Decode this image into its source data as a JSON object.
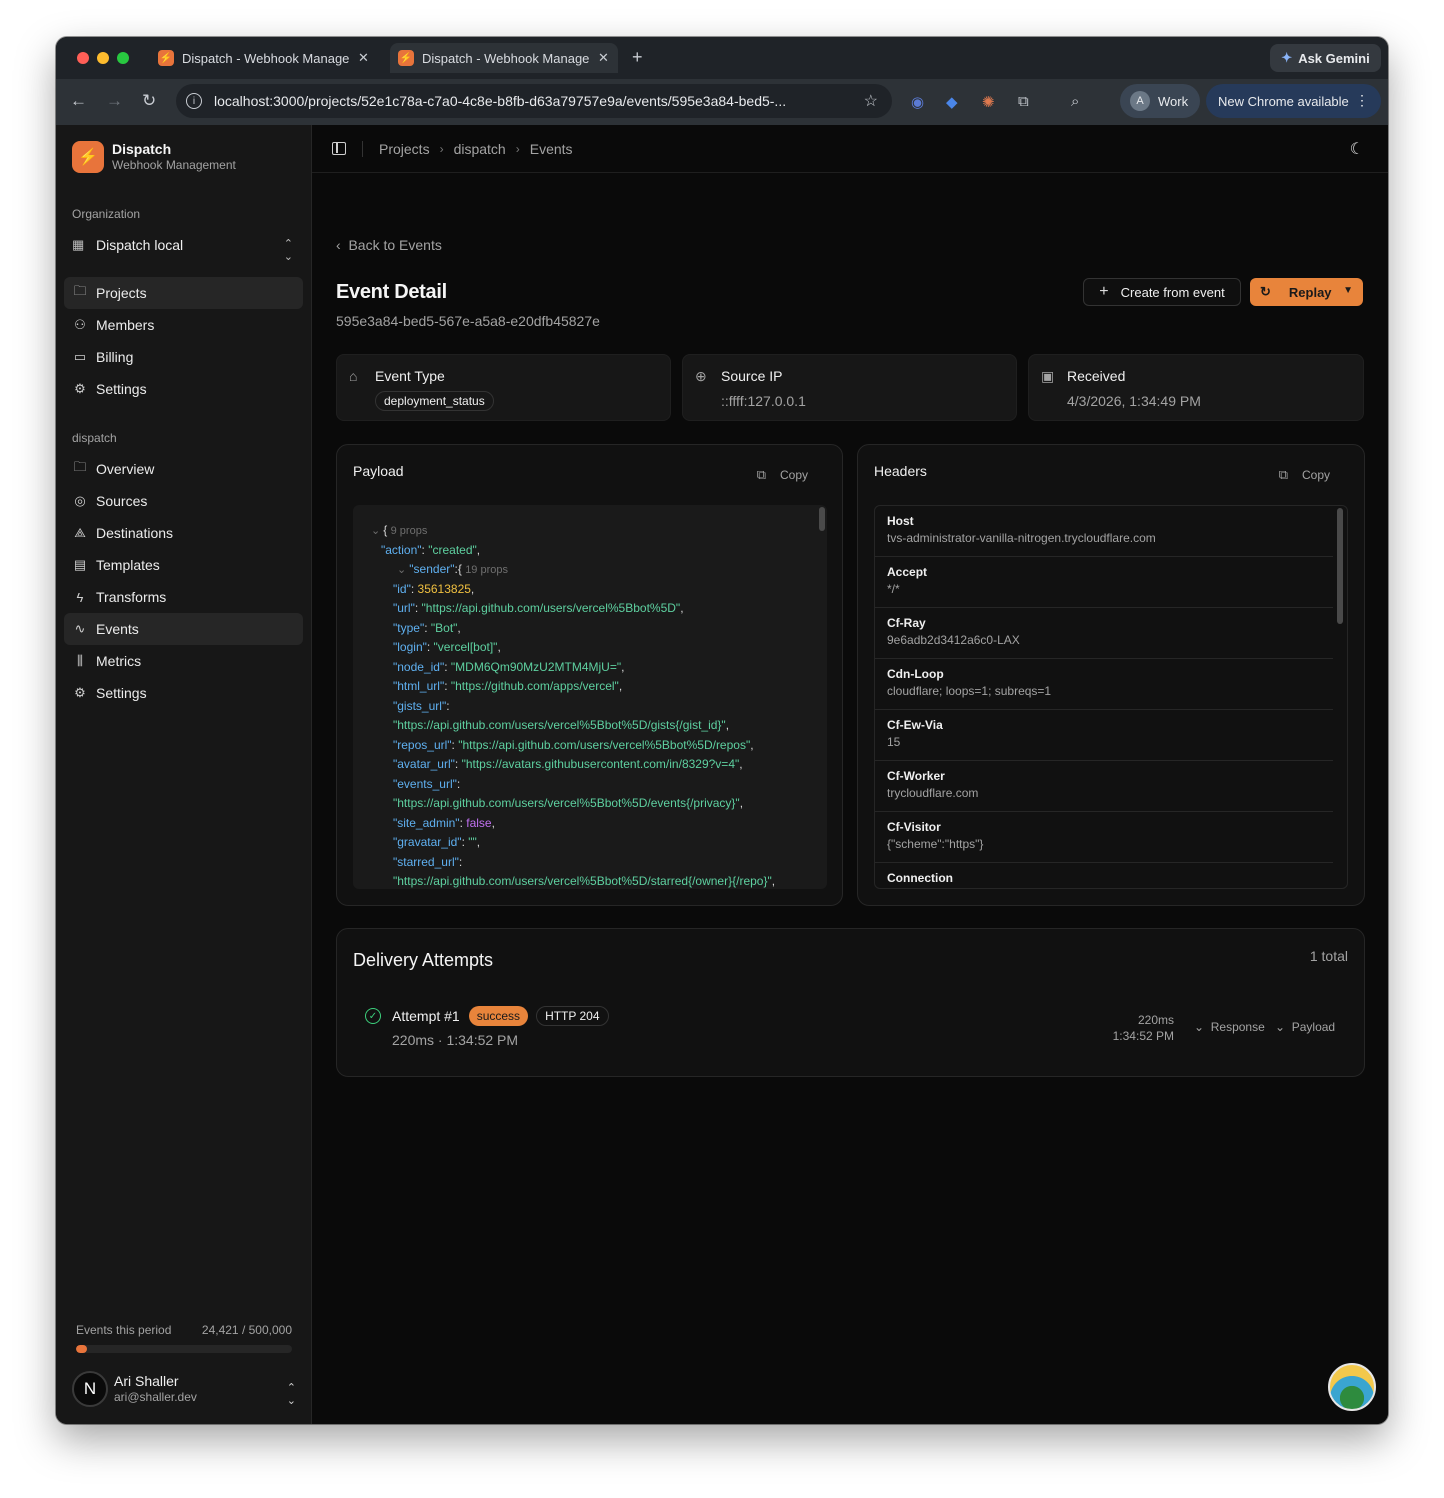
{
  "browser": {
    "tabs": [
      {
        "title": "Dispatch - Webhook Management"
      },
      {
        "title": "Dispatch - Webhook Management"
      }
    ],
    "new_tab": "+",
    "ask_gemini": "Ask Gemini",
    "url": "localhost:3000/projects/52e1c78a-c7a0-4c8e-b8fb-d63a79757e9a/events/595e3a84-bed5-...",
    "profile_initial": "A",
    "profile_label": "Work",
    "update_label": "New Chrome available"
  },
  "sidebar": {
    "brand_name": "Dispatch",
    "brand_sub": "Webhook Management",
    "org_label": "Organization",
    "org_name": "Dispatch local",
    "org_items": [
      {
        "label": "Projects",
        "icon": "folder-icon"
      },
      {
        "label": "Members",
        "icon": "users-icon"
      },
      {
        "label": "Billing",
        "icon": "credit-card-icon"
      },
      {
        "label": "Settings",
        "icon": "gear-icon"
      }
    ],
    "project_label": "dispatch",
    "project_items": [
      {
        "label": "Overview",
        "icon": "folder-icon"
      },
      {
        "label": "Sources",
        "icon": "radio-icon"
      },
      {
        "label": "Destinations",
        "icon": "webhook-icon"
      },
      {
        "label": "Templates",
        "icon": "file-icon"
      },
      {
        "label": "Transforms",
        "icon": "zap-icon"
      },
      {
        "label": "Events",
        "icon": "activity-icon"
      },
      {
        "label": "Metrics",
        "icon": "bar-chart-icon"
      },
      {
        "label": "Settings",
        "icon": "gear-icon"
      }
    ],
    "usage_label": "Events this period",
    "usage_value": "24,421 / 500,000",
    "usage_fraction": 0.0488,
    "user_initial": "N",
    "user_name": "Ari Shaller",
    "user_email": "ari@shaller.dev"
  },
  "header": {
    "breadcrumbs": [
      "Projects",
      "dispatch",
      "Events"
    ]
  },
  "event": {
    "back_label": "Back to Events",
    "title": "Event Detail",
    "id": "595e3a84-bed5-567e-a5a8-e20dfb45827e",
    "create_label": "Create from event",
    "replay_label": "Replay",
    "cards": {
      "type_label": "Event Type",
      "type_value": "deployment_status",
      "ip_label": "Source IP",
      "ip_value": "::ffff:127.0.0.1",
      "received_label": "Received",
      "received_value": "4/3/2026, 1:34:49 PM"
    }
  },
  "payload": {
    "title": "Payload",
    "copy_label": "Copy",
    "lines": [
      {
        "parts": [
          [
            "mt",
            "⌄ "
          ],
          [
            "pn",
            "{ "
          ],
          [
            "mt",
            "9 props"
          ]
        ]
      },
      {
        "parts": [
          [
            "k",
            "\"action\""
          ],
          [
            "pn",
            ": "
          ],
          [
            "s",
            "\"created\""
          ],
          [
            "pn",
            ","
          ]
        ]
      },
      {
        "parts": [
          [
            "mt",
            "⌄ "
          ],
          [
            "k",
            "\"sender\""
          ],
          [
            "pn",
            ":{ "
          ],
          [
            "mt",
            "19 props"
          ]
        ]
      },
      {
        "parts": [
          [
            "k",
            "\"id\""
          ],
          [
            "pn",
            ": "
          ],
          [
            "n",
            "35613825"
          ],
          [
            "pn",
            ","
          ]
        ]
      },
      {
        "parts": [
          [
            "k",
            "\"url\""
          ],
          [
            "pn",
            ": "
          ],
          [
            "s",
            "\"https://api.github.com/users/vercel%5Bbot%5D\""
          ],
          [
            "pn",
            ","
          ]
        ]
      },
      {
        "parts": [
          [
            "k",
            "\"type\""
          ],
          [
            "pn",
            ": "
          ],
          [
            "s",
            "\"Bot\""
          ],
          [
            "pn",
            ","
          ]
        ]
      },
      {
        "parts": [
          [
            "k",
            "\"login\""
          ],
          [
            "pn",
            ": "
          ],
          [
            "s",
            "\"vercel[bot]\""
          ],
          [
            "pn",
            ","
          ]
        ]
      },
      {
        "parts": [
          [
            "k",
            "\"node_id\""
          ],
          [
            "pn",
            ": "
          ],
          [
            "s",
            "\"MDM6Qm90MzU2MTM4MjU=\""
          ],
          [
            "pn",
            ","
          ]
        ]
      },
      {
        "parts": [
          [
            "k",
            "\"html_url\""
          ],
          [
            "pn",
            ": "
          ],
          [
            "s",
            "\"https://github.com/apps/vercel\""
          ],
          [
            "pn",
            ","
          ]
        ]
      },
      {
        "parts": [
          [
            "k",
            "\"gists_url\""
          ],
          [
            "pn",
            ":"
          ]
        ]
      },
      {
        "parts": [
          [
            "s",
            "\"https://api.github.com/users/vercel%5Bbot%5D/gists{/gist_id}\""
          ],
          [
            "pn",
            ","
          ]
        ]
      },
      {
        "parts": [
          [
            "k",
            "\"repos_url\""
          ],
          [
            "pn",
            ": "
          ],
          [
            "s",
            "\"https://api.github.com/users/vercel%5Bbot%5D/repos\""
          ],
          [
            "pn",
            ","
          ]
        ]
      },
      {
        "parts": [
          [
            "k",
            "\"avatar_url\""
          ],
          [
            "pn",
            ": "
          ],
          [
            "s",
            "\"https://avatars.githubusercontent.com/in/8329?v=4\""
          ],
          [
            "pn",
            ","
          ]
        ]
      },
      {
        "parts": [
          [
            "k",
            "\"events_url\""
          ],
          [
            "pn",
            ":"
          ]
        ]
      },
      {
        "parts": [
          [
            "s",
            "\"https://api.github.com/users/vercel%5Bbot%5D/events{/privacy}\""
          ],
          [
            "pn",
            ","
          ]
        ]
      },
      {
        "parts": [
          [
            "k",
            "\"site_admin\""
          ],
          [
            "pn",
            ": "
          ],
          [
            "b",
            "false"
          ],
          [
            "pn",
            ","
          ]
        ]
      },
      {
        "parts": [
          [
            "k",
            "\"gravatar_id\""
          ],
          [
            "pn",
            ": "
          ],
          [
            "s",
            "\"\""
          ],
          [
            "pn",
            ","
          ]
        ]
      },
      {
        "parts": [
          [
            "k",
            "\"starred_url\""
          ],
          [
            "pn",
            ":"
          ]
        ]
      },
      {
        "parts": [
          [
            "s",
            "\"https://api.github.com/users/vercel%5Bbot%5D/starred{/owner}{/repo}\""
          ],
          [
            "pn",
            ","
          ]
        ]
      }
    ]
  },
  "headers": {
    "title": "Headers",
    "copy_label": "Copy",
    "rows": [
      {
        "name": "Host",
        "value": "tvs-administrator-vanilla-nitrogen.trycloudflare.com"
      },
      {
        "name": "Accept",
        "value": "*/*"
      },
      {
        "name": "Cf-Ray",
        "value": "9e6adb2d3412a6c0-LAX"
      },
      {
        "name": "Cdn-Loop",
        "value": "cloudflare; loops=1; subreqs=1"
      },
      {
        "name": "Cf-Ew-Via",
        "value": "15"
      },
      {
        "name": "Cf-Worker",
        "value": "trycloudflare.com"
      },
      {
        "name": "Cf-Visitor",
        "value": "{\"scheme\":\"https\"}"
      },
      {
        "name": "Connection",
        "value": ""
      }
    ]
  },
  "delivery": {
    "title": "Delivery Attempts",
    "total": "1 total",
    "attempt": {
      "name": "Attempt #1",
      "status": "success",
      "http": "HTTP 204",
      "summary": "220ms · 1:34:52 PM",
      "duration": "220ms",
      "time": "1:34:52 PM",
      "response_label": "Response",
      "payload_label": "Payload"
    }
  },
  "colors": {
    "accent": "#e8843b",
    "success": "#3ccf7c",
    "json_key": "#5fb0f0",
    "json_string": "#5ed0a0",
    "json_number": "#f0c040",
    "json_bool": "#c070f0"
  }
}
